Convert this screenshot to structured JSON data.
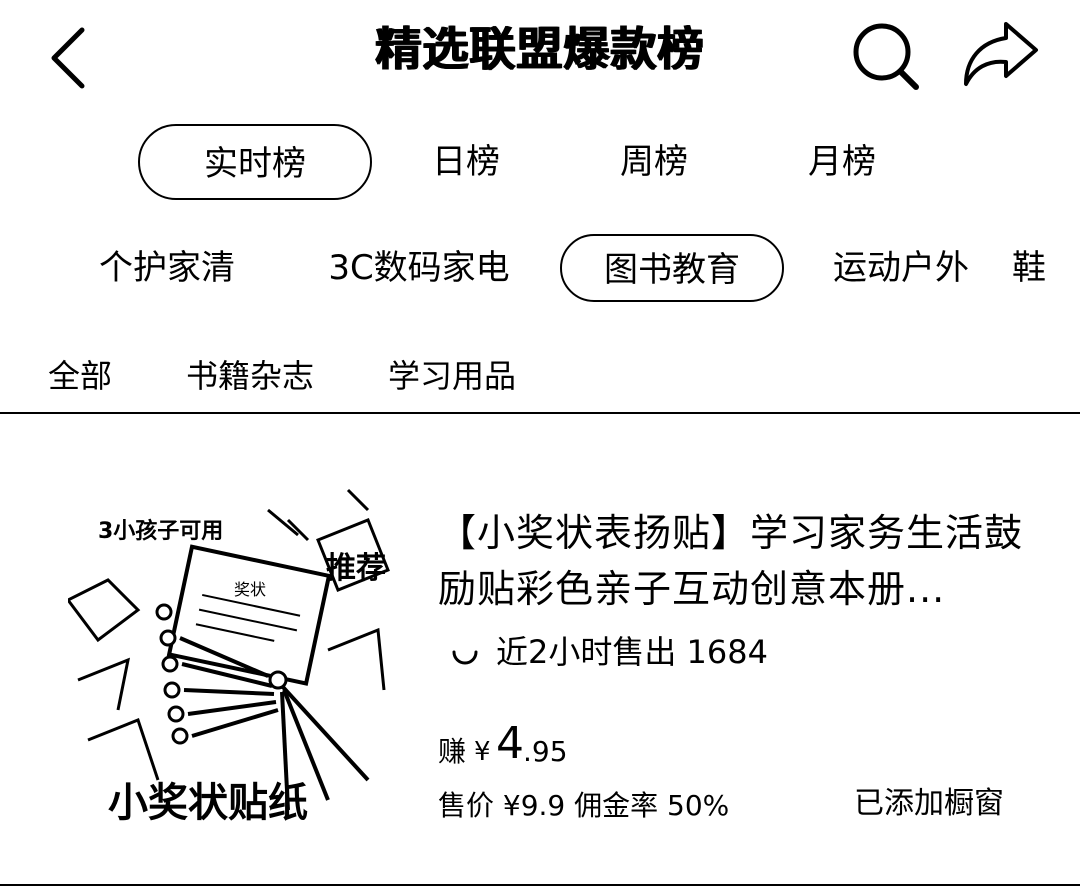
{
  "header": {
    "title": "精选联盟爆款榜",
    "back_icon": "chevron-left-icon",
    "search_icon": "search-icon",
    "share_icon": "share-icon"
  },
  "rank_tabs": [
    {
      "label": "实时榜",
      "active": true
    },
    {
      "label": "日榜",
      "active": false
    },
    {
      "label": "周榜",
      "active": false
    },
    {
      "label": "月榜",
      "active": false
    }
  ],
  "category_tabs": [
    {
      "label": "个护家清",
      "active": false
    },
    {
      "label": "3C数码家电",
      "active": false
    },
    {
      "label": "图书教育",
      "active": true
    },
    {
      "label": "运动户外",
      "active": false
    },
    {
      "label": "鞋",
      "active": false
    }
  ],
  "sub_tabs": [
    {
      "label": "全部"
    },
    {
      "label": "书籍杂志"
    },
    {
      "label": "学习用品"
    }
  ],
  "product": {
    "image_texts": {
      "top_left": "3小孩子可用",
      "top_right": "推荐",
      "certificate": "奖状",
      "bottom": "小奖状贴纸"
    },
    "title": "【小奖状表扬贴】学习家务生活鼓励贴彩色亲子互动创意本册...",
    "sold_text": "近2小时售出 1684",
    "earn_label": "赚",
    "earn_currency": "¥",
    "earn_int": "4",
    "earn_dec": ".95",
    "price_line": "售价 ¥9.9  佣金率 50%",
    "showcase_status": "已添加橱窗"
  }
}
